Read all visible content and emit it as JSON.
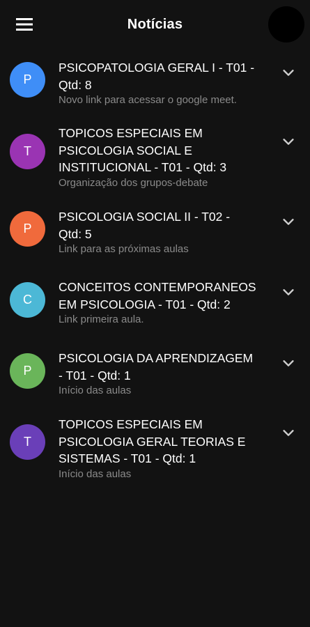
{
  "header": {
    "title": "Notícias",
    "menu_icon": "menu-icon",
    "profile_avatar": "avatar"
  },
  "items": [
    {
      "initial": "P",
      "color": "#3f8ef7",
      "title_lines": [
        "PSICOPATOLOGIA GERAL I - T01 -",
        "Qtd: 8"
      ],
      "subtitle": "Novo link para acessar o google meet."
    },
    {
      "initial": "T",
      "color": "#9a34b3",
      "title_lines": [
        "TOPICOS ESPECIAIS EM",
        "PSICOLOGIA SOCIAL E",
        "INSTITUCIONAL - T01 - Qtd: 3"
      ],
      "subtitle": "Organização dos grupos-debate"
    },
    {
      "initial": "P",
      "color": "#f06a3c",
      "title_lines": [
        "PSICOLOGIA SOCIAL II - T02 -",
        "Qtd: 5"
      ],
      "subtitle": "Link para as próximas aulas"
    },
    {
      "initial": "C",
      "color": "#4cb8d6",
      "title_lines": [
        "CONCEITOS CONTEMPORANEOS",
        "EM PSICOLOGIA - T01 - Qtd: 2"
      ],
      "subtitle": "Link primeira aula."
    },
    {
      "initial": "P",
      "color": "#6ab55a",
      "title_lines": [
        "PSICOLOGIA DA APRENDIZAGEM",
        "- T01 - Qtd: 1"
      ],
      "subtitle": "Início das aulas"
    },
    {
      "initial": "T",
      "color": "#6a3fb8",
      "title_lines": [
        "TOPICOS ESPECIAIS EM",
        "PSICOLOGIA GERAL TEORIAS E",
        "SISTEMAS - T01 - Qtd: 1"
      ],
      "subtitle": "Início das aulas"
    }
  ]
}
